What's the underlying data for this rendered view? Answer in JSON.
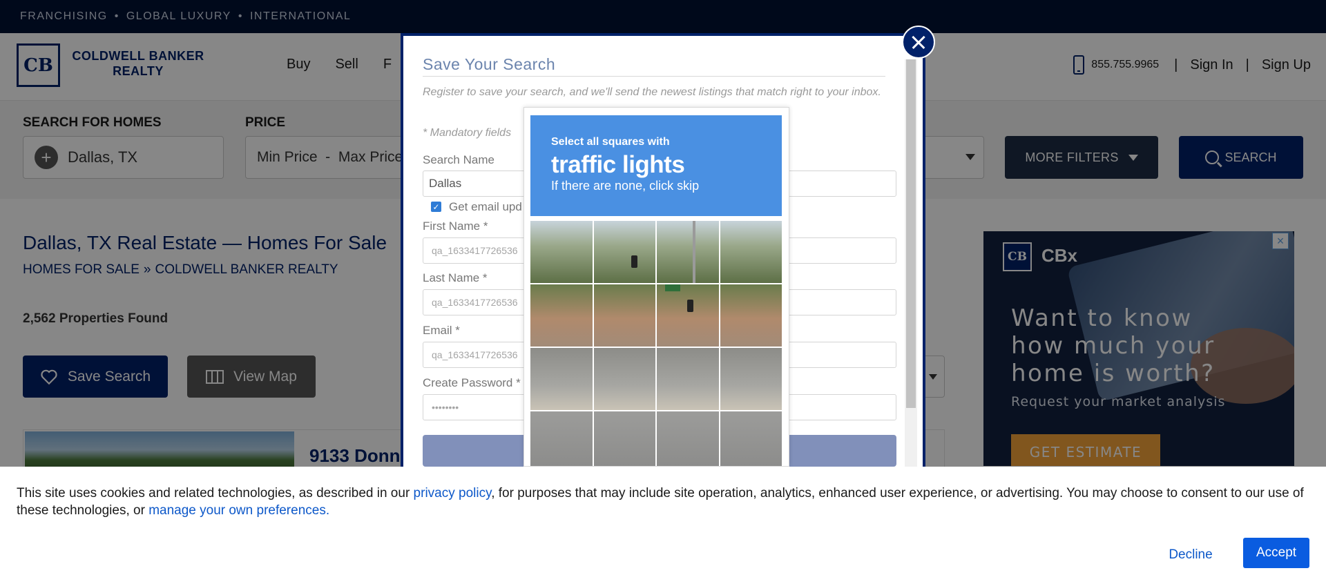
{
  "topbar": {
    "items": [
      "FRANCHISING",
      "GLOBAL LUXURY",
      "INTERNATIONAL"
    ],
    "separator": "•"
  },
  "header": {
    "logo_mark": "CB",
    "logo_line1": "COLDWELL BANKER",
    "logo_line2": "REALTY",
    "nav": [
      "Buy",
      "Sell",
      "F"
    ],
    "phone": "855.755.9965",
    "divider": "|",
    "sign_in": "Sign In",
    "sign_up": "Sign Up"
  },
  "filters": {
    "location_label": "SEARCH FOR HOMES",
    "location_value": "Dallas, TX",
    "price_label": "PRICE",
    "price_value": "Min Price  -  Max Price",
    "more_filters": "MORE FILTERS",
    "search": "SEARCH"
  },
  "main": {
    "title": "Dallas, TX Real Estate — Homes For Sale",
    "breadcrumb": [
      "HOMES FOR SALE",
      "COLDWELL BANKER REALTY"
    ],
    "breadcrumb_sep": "»",
    "count": "2,562 Properties Found",
    "save_search": "Save Search",
    "view_map": "View Map",
    "listing_address": "9133 Donn"
  },
  "ad": {
    "logo_mark": "CB",
    "brand": "CBx",
    "headline": "Want to know how much your home is worth?",
    "sub": "Request your market analysis",
    "cta": "GET ESTIMATE",
    "close": "×"
  },
  "modal": {
    "title": "Save Your Search",
    "intro": "Register to save your search, and we'll send the newest listings that match right to your inbox.",
    "mandatory": "* Mandatory fields",
    "search_name_label": "Search Name",
    "search_name_value": "Dallas",
    "email_updates_label": "Get email upd",
    "email_updates_checked": true,
    "first_name_label": "First Name *",
    "first_name_value": "qa_1633417726536",
    "last_name_label": "Last Name *",
    "last_name_value": "qa_1633417726536",
    "email_label": "Email *",
    "email_value": "qa_1633417726536",
    "password_label": "Create Password *",
    "password_value": "••••••••"
  },
  "captcha": {
    "instruction": "Select all squares with",
    "target": "traffic lights",
    "hint": "If there are none, click skip",
    "grid_rows": 4,
    "grid_cols": 4
  },
  "cookie": {
    "text_before": "This site uses cookies and related technologies, as described in our ",
    "privacy_link": "privacy policy",
    "text_middle": ", for purposes that may include site operation, analytics, enhanced user experience, or advertising. You may choose to consent to our use of these technologies, or ",
    "prefs_link": "manage your own preferences",
    "text_after": ".",
    "decline": "Decline",
    "accept": "Accept"
  },
  "colors": {
    "brand_navy": "#012169",
    "topbar": "#001134",
    "accent_blue": "#0a5ce0",
    "captcha_blue": "#4a90e2",
    "ad_cta": "#f3a33a"
  }
}
